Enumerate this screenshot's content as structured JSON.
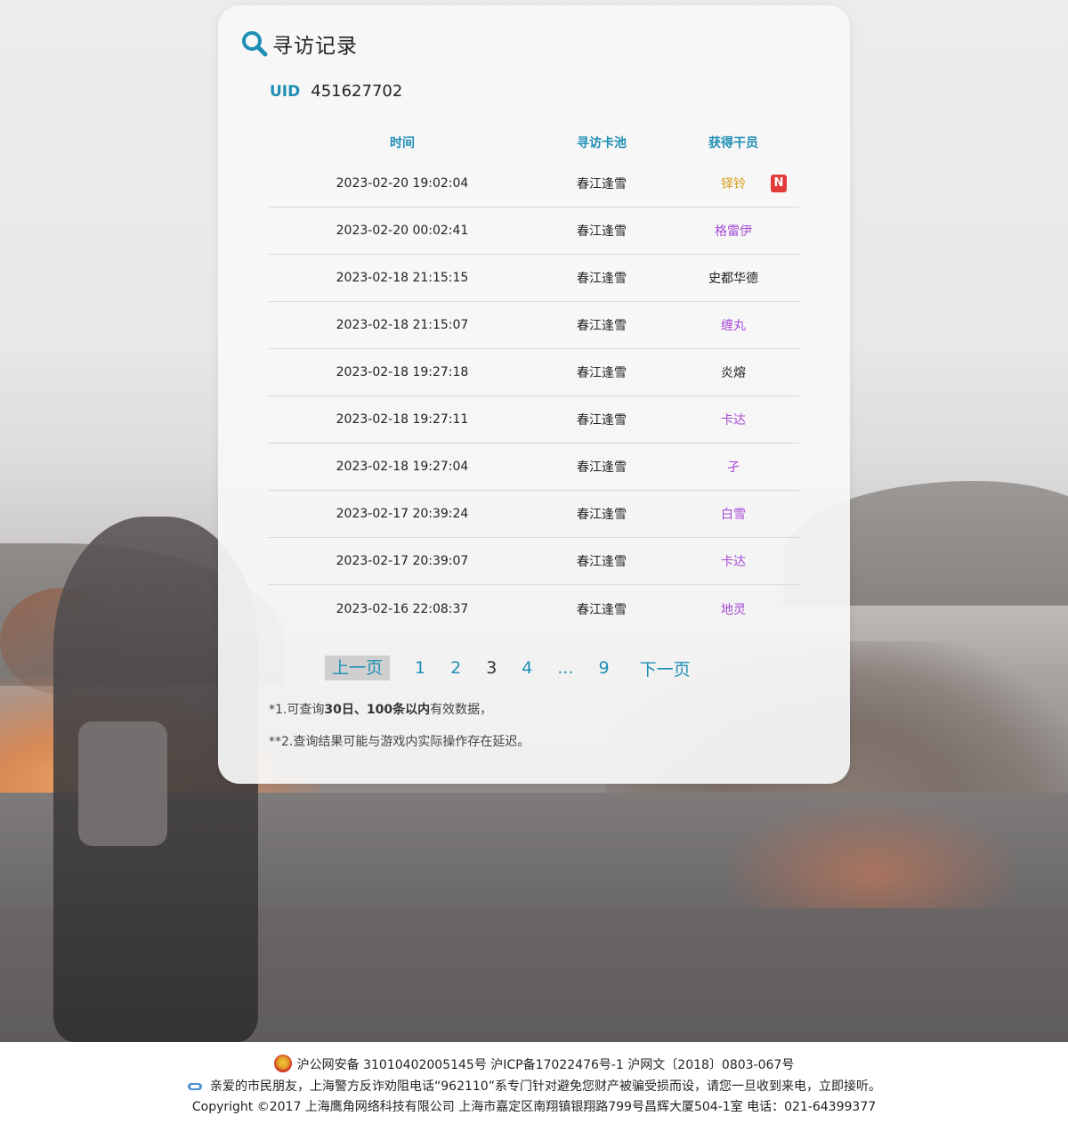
{
  "header": {
    "title": "寻访记录"
  },
  "uid": {
    "label": "UID",
    "value": "451627702"
  },
  "table": {
    "columns": [
      "时间",
      "寻访卡池",
      "获得干员"
    ],
    "rows": [
      {
        "time": "2023-02-20 19:02:04",
        "pool": "春江逢雪",
        "operator": "铎铃",
        "color": "#d9a020",
        "badge": "N"
      },
      {
        "time": "2023-02-20 00:02:41",
        "pool": "春江逢雪",
        "operator": "格雷伊",
        "color": "#a64bd6"
      },
      {
        "time": "2023-02-18 21:15:15",
        "pool": "春江逢雪",
        "operator": "史都华德",
        "color": "#222222"
      },
      {
        "time": "2023-02-18 21:15:07",
        "pool": "春江逢雪",
        "operator": "缠丸",
        "color": "#a64bd6"
      },
      {
        "time": "2023-02-18 19:27:18",
        "pool": "春江逢雪",
        "operator": "炎熔",
        "color": "#222222"
      },
      {
        "time": "2023-02-18 19:27:11",
        "pool": "春江逢雪",
        "operator": "卡达",
        "color": "#a64bd6"
      },
      {
        "time": "2023-02-18 19:27:04",
        "pool": "春江逢雪",
        "operator": "孑",
        "color": "#a64bd6"
      },
      {
        "time": "2023-02-17 20:39:24",
        "pool": "春江逢雪",
        "operator": "白雪",
        "color": "#a64bd6"
      },
      {
        "time": "2023-02-17 20:39:07",
        "pool": "春江逢雪",
        "operator": "卡达",
        "color": "#a64bd6"
      },
      {
        "time": "2023-02-16 22:08:37",
        "pool": "春江逢雪",
        "operator": "地灵",
        "color": "#a64bd6"
      }
    ]
  },
  "pager": {
    "prev": "上一页",
    "pages": [
      "1",
      "2",
      "3",
      "4",
      "...",
      "9"
    ],
    "current": "3",
    "next": "下一页"
  },
  "notes": {
    "n1_prefix": "*1.可查询",
    "n1_bold": "30日、100条以内",
    "n1_suffix": "有效数据，",
    "n2": "**2.查询结果可能与游戏内实际操作存在延迟。"
  },
  "footer": {
    "line1": "沪公网安备 31010402005145号  沪ICP备17022476号-1  沪网文〔2018〕0803-067号",
    "line2": "亲爱的市民朋友，上海警方反诈劝阻电话“962110”系专门针对避免您财产被骗受损而设，请您一旦收到来电，立即接听。",
    "line3": "Copyright ©2017 上海鹰角网络科技有限公司  上海市嘉定区南翔镇银翔路799号昌辉大厦504-1室  电话：021-64399377"
  }
}
